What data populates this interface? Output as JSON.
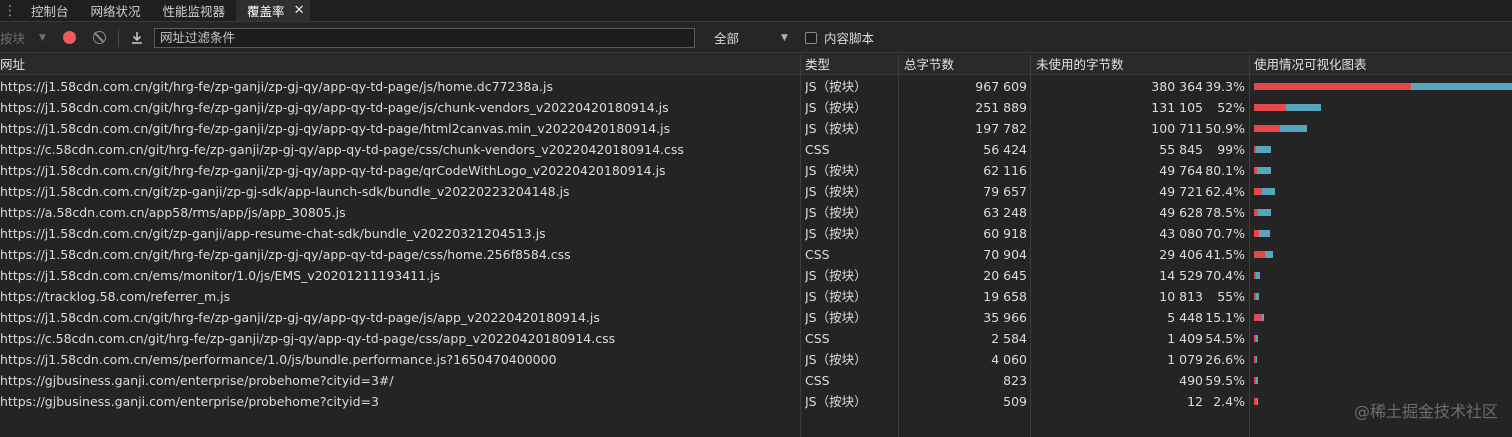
{
  "tabs": [
    {
      "label": "控制台"
    },
    {
      "label": "网络状况"
    },
    {
      "label": "性能监视器"
    },
    {
      "label": "覆盖率",
      "active": true
    }
  ],
  "toolbar": {
    "mode_label": "按块",
    "filter_placeholder": "网址过滤条件",
    "scope_value": "全部",
    "content_scripts_label": "内容脚本"
  },
  "columns": {
    "url": "网址",
    "type": "类型",
    "total": "总字节数",
    "unused": "未使用的字节数",
    "viz": "使用情况可视化图表"
  },
  "colors": {
    "used": "#e5484d",
    "unused": "#56a6bd",
    "record": "#ef5a5a"
  },
  "rows": [
    {
      "url": "https://j1.58cdn.com.cn/git/hrg-fe/zp-ganji/zp-gj-qy/app-qy-td-page/js/home.dc77238a.js",
      "type": "JS（按块）",
      "total": "967 609",
      "unused": "380 364",
      "pct": "39.3%",
      "total_n": 967609,
      "unused_n": 380364
    },
    {
      "url": "https://j1.58cdn.com.cn/git/hrg-fe/zp-ganji/zp-gj-qy/app-qy-td-page/js/chunk-vendors_v20220420180914.js",
      "type": "JS（按块）",
      "total": "251 889",
      "unused": "131 105",
      "pct": "52%",
      "total_n": 251889,
      "unused_n": 131105
    },
    {
      "url": "https://j1.58cdn.com.cn/git/hrg-fe/zp-ganji/zp-gj-qy/app-qy-td-page/html2canvas.min_v20220420180914.js",
      "type": "JS（按块）",
      "total": "197 782",
      "unused": "100 711",
      "pct": "50.9%",
      "total_n": 197782,
      "unused_n": 100711
    },
    {
      "url": "https://c.58cdn.com.cn/git/hrg-fe/zp-ganji/zp-gj-qy/app-qy-td-page/css/chunk-vendors_v20220420180914.css",
      "type": "CSS",
      "total": "56 424",
      "unused": "55 845",
      "pct": "99%",
      "total_n": 56424,
      "unused_n": 55845
    },
    {
      "url": "https://j1.58cdn.com.cn/git/hrg-fe/zp-ganji/zp-gj-qy/app-qy-td-page/qrCodeWithLogo_v20220420180914.js",
      "type": "JS（按块）",
      "total": "62 116",
      "unused": "49 764",
      "pct": "80.1%",
      "total_n": 62116,
      "unused_n": 49764
    },
    {
      "url": "https://j1.58cdn.com.cn/git/zp-ganji/zp-gj-sdk/app-launch-sdk/bundle_v20220223204148.js",
      "type": "JS（按块）",
      "total": "79 657",
      "unused": "49 721",
      "pct": "62.4%",
      "total_n": 79657,
      "unused_n": 49721
    },
    {
      "url": "https://a.58cdn.com.cn/app58/rms/app/js/app_30805.js",
      "type": "JS（按块）",
      "total": "63 248",
      "unused": "49 628",
      "pct": "78.5%",
      "total_n": 63248,
      "unused_n": 49628
    },
    {
      "url": "https://j1.58cdn.com.cn/git/zp-ganji/app-resume-chat-sdk/bundle_v20220321204513.js",
      "type": "JS（按块）",
      "total": "60 918",
      "unused": "43 080",
      "pct": "70.7%",
      "total_n": 60918,
      "unused_n": 43080
    },
    {
      "url": "https://j1.58cdn.com.cn/git/hrg-fe/zp-ganji/zp-gj-qy/app-qy-td-page/css/home.256f8584.css",
      "type": "CSS",
      "total": "70 904",
      "unused": "29 406",
      "pct": "41.5%",
      "total_n": 70904,
      "unused_n": 29406
    },
    {
      "url": "https://j1.58cdn.com.cn/ems/monitor/1.0/js/EMS_v20201211193411.js",
      "type": "JS（按块）",
      "total": "20 645",
      "unused": "14 529",
      "pct": "70.4%",
      "total_n": 20645,
      "unused_n": 14529
    },
    {
      "url": "https://tracklog.58.com/referrer_m.js",
      "type": "JS（按块）",
      "total": "19 658",
      "unused": "10 813",
      "pct": "55%",
      "total_n": 19658,
      "unused_n": 10813
    },
    {
      "url": "https://j1.58cdn.com.cn/git/hrg-fe/zp-ganji/zp-gj-qy/app-qy-td-page/js/app_v20220420180914.js",
      "type": "JS（按块）",
      "total": "35 966",
      "unused": "5 448",
      "pct": "15.1%",
      "total_n": 35966,
      "unused_n": 5448
    },
    {
      "url": "https://c.58cdn.com.cn/git/hrg-fe/zp-ganji/zp-gj-qy/app-qy-td-page/css/app_v20220420180914.css",
      "type": "CSS",
      "total": "2 584",
      "unused": "1 409",
      "pct": "54.5%",
      "total_n": 2584,
      "unused_n": 1409
    },
    {
      "url": "https://j1.58cdn.com.cn/ems/performance/1.0/js/bundle.performance.js?1650470400000",
      "type": "JS（按块）",
      "total": "4 060",
      "unused": "1 079",
      "pct": "26.6%",
      "total_n": 4060,
      "unused_n": 1079
    },
    {
      "url": "https://gjbusiness.ganji.com/enterprise/probehome?cityid=3#/",
      "type": "CSS",
      "total": "823",
      "unused": "490",
      "pct": "59.5%",
      "total_n": 823,
      "unused_n": 490
    },
    {
      "url": "https://gjbusiness.ganji.com/enterprise/probehome?cityid=3",
      "type": "JS（按块）",
      "total": "509",
      "unused": "12",
      "pct": "2.4%",
      "total_n": 509,
      "unused_n": 12
    }
  ],
  "watermark": "@稀土掘金技术社区"
}
